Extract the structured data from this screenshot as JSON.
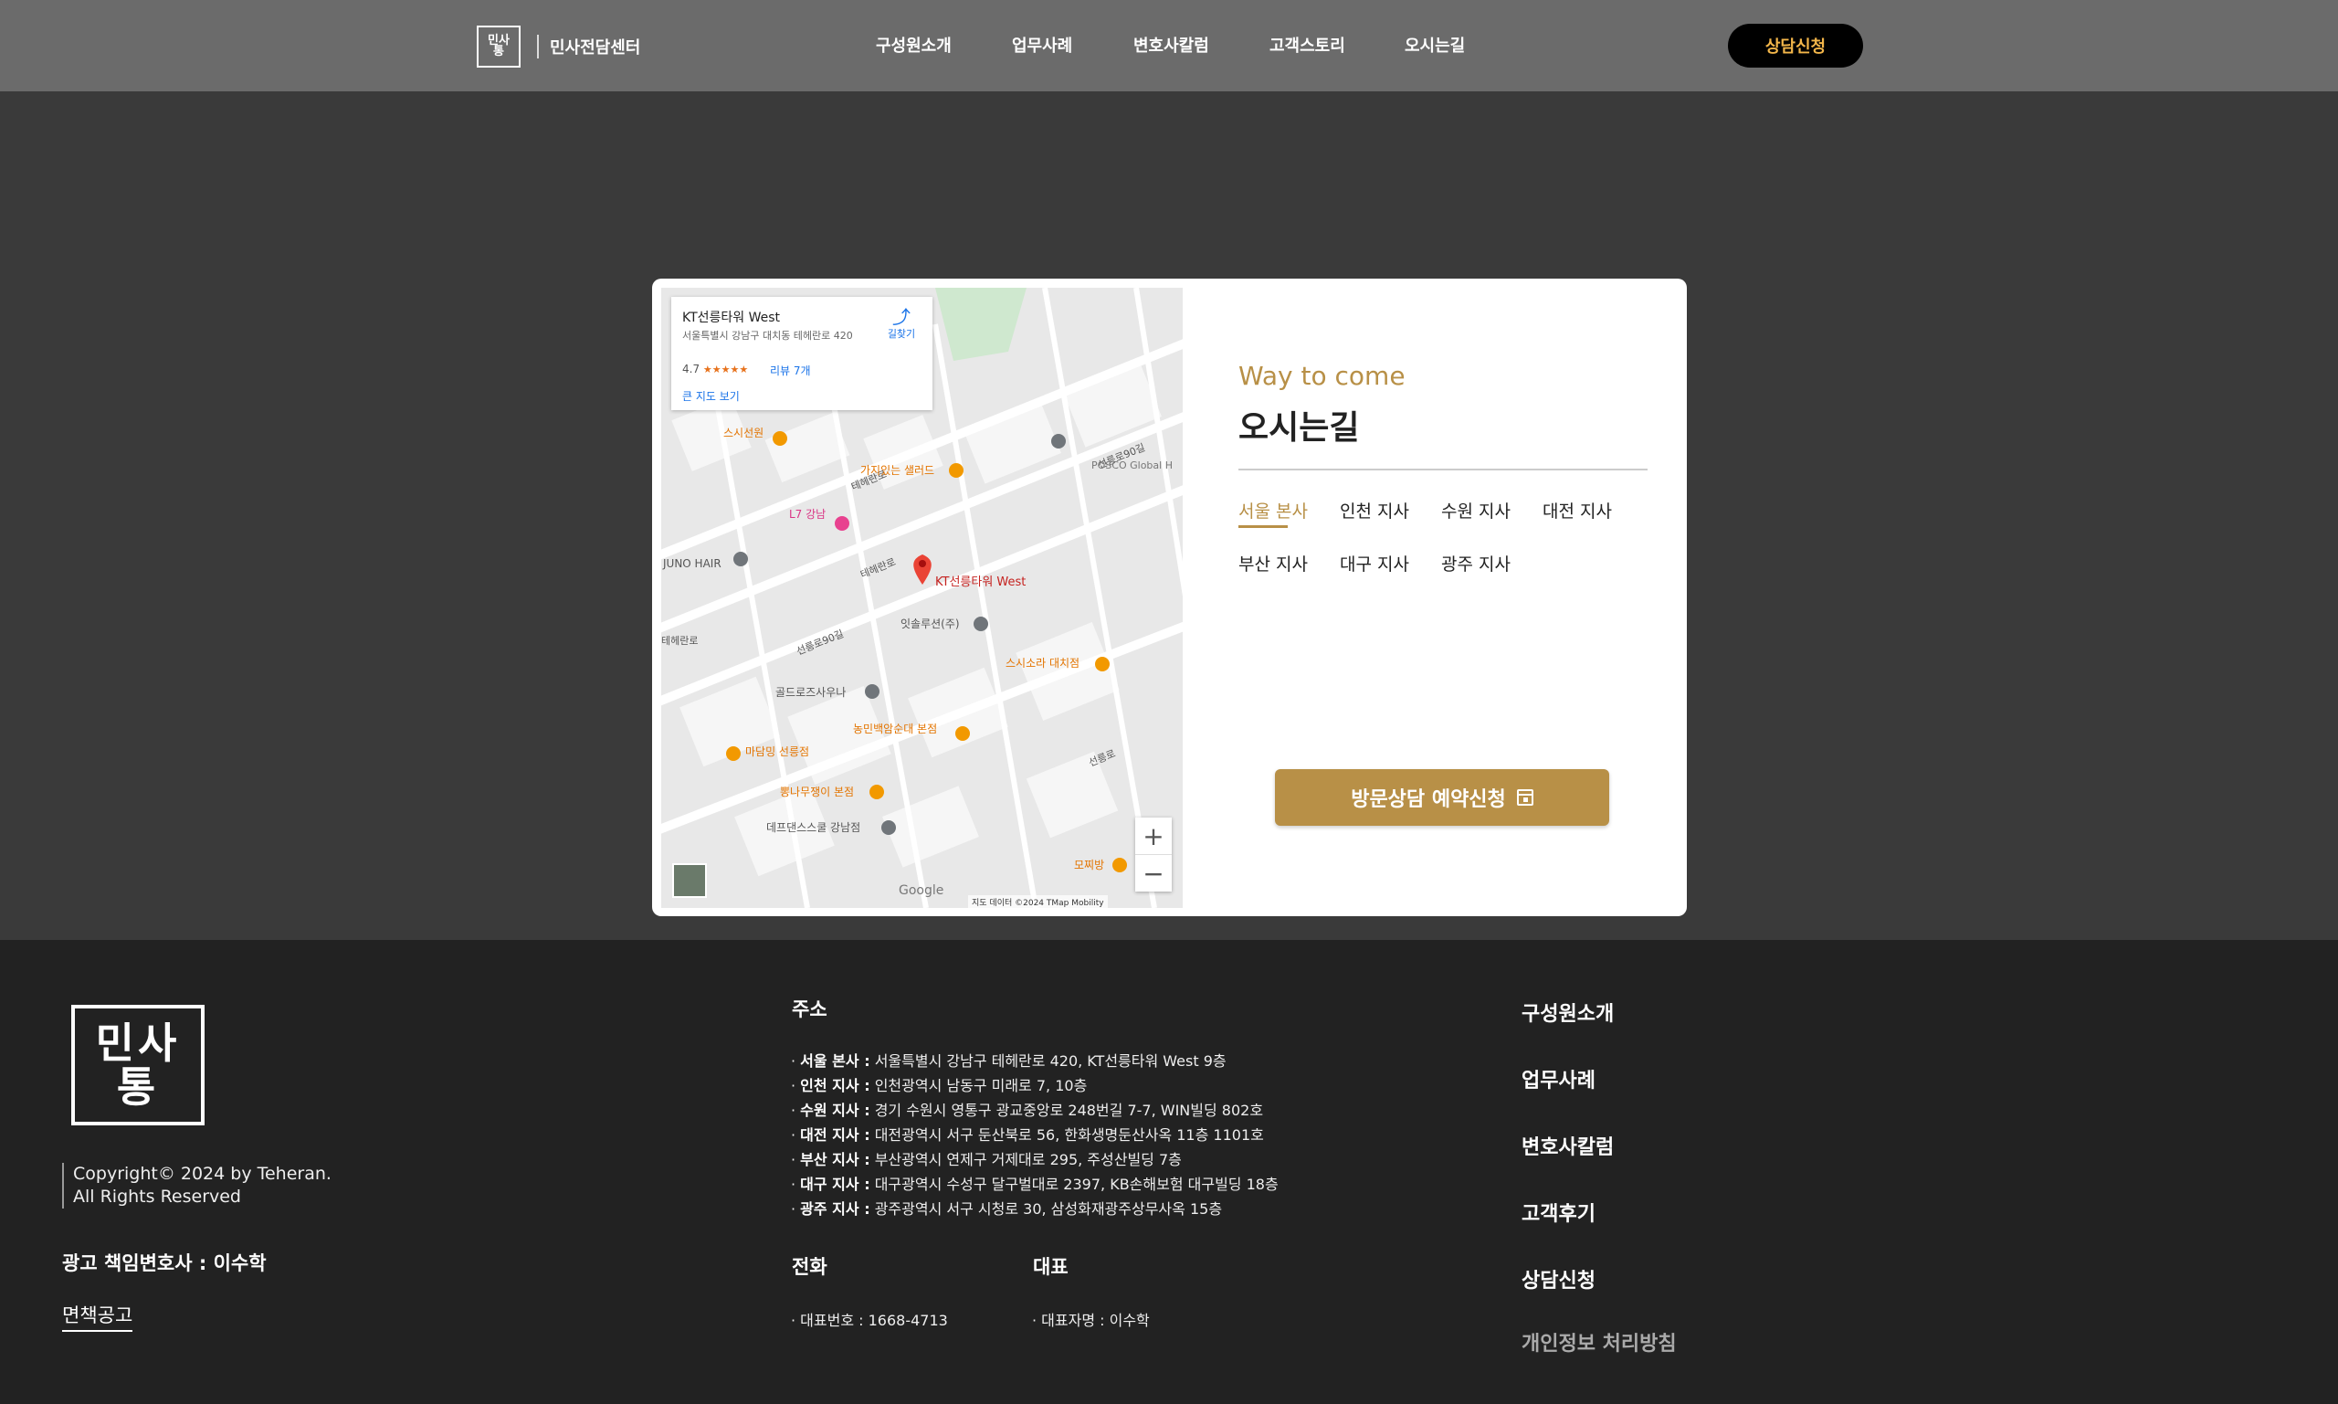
{
  "header": {
    "logo_glyph": "민사\n통",
    "logo_text": "민사전담센터",
    "nav": [
      "구성원소개",
      "업무사례",
      "변호사칼럼",
      "고객스토리",
      "오시는길"
    ],
    "cta": "상담신청"
  },
  "map": {
    "info_title": "KT선릉타워 West",
    "info_address": "서울특별시 강남구 대치동 테헤란로 420",
    "info_rating": "4.7",
    "info_stars": "★★★★★",
    "info_reviews": "리뷰 7개",
    "info_bigmap": "큰 지도 보기",
    "info_directions": "길찾기",
    "pin_label": "KT선릉타워 West",
    "zoom_in": "+",
    "zoom_out": "−",
    "google": "Google",
    "attribution": "지도 데이터 ©2024 TMap Mobility",
    "places": {
      "p1": "스시선원",
      "p2": "가지있는 샐러드",
      "p3": "L7 강남",
      "p4": "JUNO HAIR",
      "p5": "잇솔루션(주)",
      "p6": "스시소라 대치점",
      "p7": "골드로즈사우나",
      "p8": "농민백암순대 본점",
      "p9": "마담밍 선릉점",
      "p10": "뽕나무쟁이 본점",
      "p11": "데프댄스스쿨 강남점",
      "p12": "모찌방",
      "p13": "POSCO Global H",
      "p14": "테헤란로",
      "p15": "선릉로90길",
      "p16": "선릉로"
    }
  },
  "location": {
    "subtitle": "Way to come",
    "title": "오시는길",
    "tabs": [
      "서울 본사",
      "인천 지사",
      "수원 지사",
      "대전 지사",
      "부산 지사",
      "대구 지사",
      "광주 지사"
    ],
    "active_tab": "서울 본사",
    "book_button": "방문상담 예약신청"
  },
  "footer": {
    "logo_glyph": "민사\n통",
    "copyright_1": "Copyright© 2024 by Teheran.",
    "copyright_2": "All Rights Reserved",
    "ad_lawyer": "광고 책임변호사 : 이수학",
    "disclaimer": "면책공고",
    "address_heading": "주소",
    "addresses": [
      {
        "name": "서울 본사 :",
        "addr": "서울특별시 강남구 테헤란로 420, KT선릉타워 West 9층"
      },
      {
        "name": "인천 지사 :",
        "addr": "인천광역시 남동구 미래로 7, 10층"
      },
      {
        "name": "수원 지사 :",
        "addr": "경기 수원시 영통구 광교중앙로 248번길 7-7, WIN빌딩 802호"
      },
      {
        "name": "대전 지사 :",
        "addr": "대전광역시 서구 둔산북로 56, 한화생명둔산사옥 11층 1101호"
      },
      {
        "name": "부산 지사 :",
        "addr": "부산광역시 연제구 거제대로 295, 주성산빌딩 7층"
      },
      {
        "name": "대구 지사 :",
        "addr": "대구광역시 수성구 달구벌대로 2397, KB손해보험 대구빌딩 18층"
      },
      {
        "name": "광주 지사 :",
        "addr": "광주광역시 서구 시청로 30, 삼성화재광주상무사옥 15층"
      }
    ],
    "phone_heading": "전화",
    "phone_line": "대표번호 : 1668-4713",
    "rep_heading": "대표",
    "rep_line": "대표자명 : 이수학",
    "nav": [
      "구성원소개",
      "업무사례",
      "변호사칼럼",
      "고객후기",
      "상담신청",
      "개인정보 처리방침"
    ]
  }
}
